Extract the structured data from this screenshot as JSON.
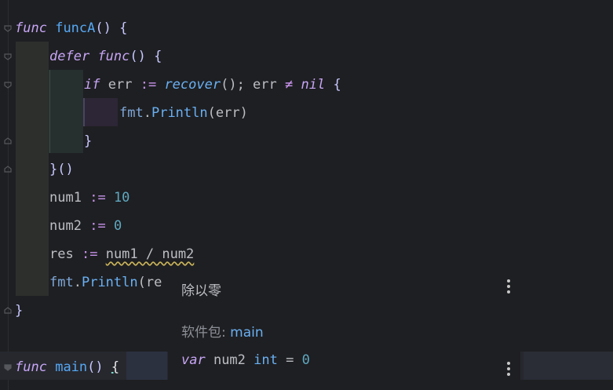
{
  "code": {
    "l1": {
      "kw": "func",
      "name": "funcA",
      "rest": "() {"
    },
    "l2": {
      "kw": "defer",
      "kw2": "func",
      "rest": "() {"
    },
    "l3": {
      "kw": "if",
      "v": "err",
      "op": ":=",
      "fn": "recover",
      "rest1": "(); ",
      "v2": "err",
      "ne": "≠",
      "nil": "nil",
      "brace": "{"
    },
    "l4": {
      "pkg": "fmt",
      "dot": ".",
      "fn": "Println",
      "rest": "(err)"
    },
    "l5": {
      "brace": "}"
    },
    "l6": {
      "text": "}()"
    },
    "l7": {
      "v": "num1",
      "op": ":=",
      "num": "10"
    },
    "l8": {
      "v": "num2",
      "op": ":=",
      "num": "0"
    },
    "l9": {
      "v": "res",
      "op": ":=",
      "expr": "num1 / num2"
    },
    "l10": {
      "pkg": "fmt",
      "dot": ".",
      "fn": "Println",
      "rest": "(re"
    },
    "l11": {
      "brace": "}"
    },
    "l12": {
      "kw": "func",
      "name": "main",
      "rest": "() ",
      "brace": "{"
    }
  },
  "popup": {
    "title": "除以零",
    "pkg_label": "软件包: ",
    "pkg_name": "main",
    "code_kw": "var",
    "code_rest": " num2 ",
    "code_type": "int",
    "code_eq": " = ",
    "code_val": "0"
  },
  "icons": [
    "fold-arrow-icon",
    "more-vertical-icon"
  ]
}
